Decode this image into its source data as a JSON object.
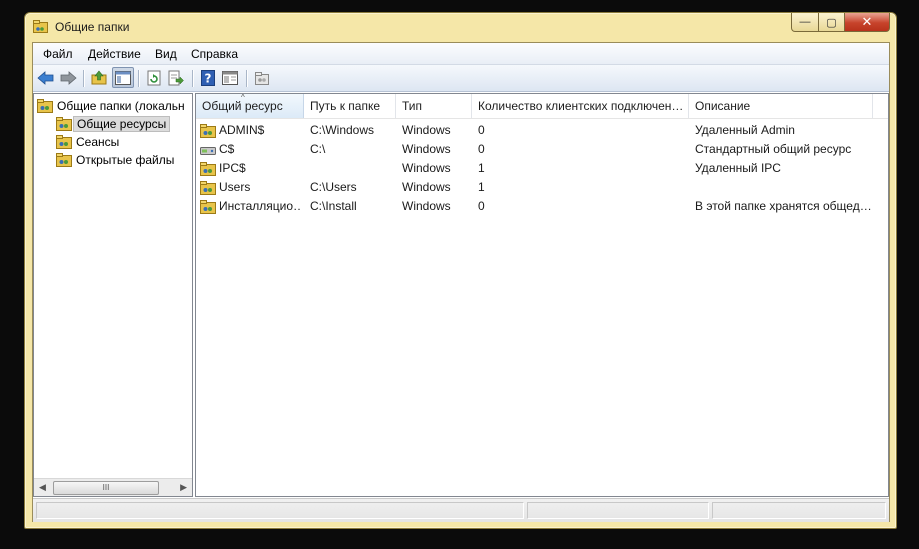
{
  "window": {
    "title": "Общие папки"
  },
  "caption": {
    "minimize": "—",
    "maximize": "▢",
    "close": "✕"
  },
  "menu": [
    {
      "label": "Файл"
    },
    {
      "label": "Действие"
    },
    {
      "label": "Вид"
    },
    {
      "label": "Справка"
    }
  ],
  "toolbar": {
    "buttons": [
      {
        "name": "back-arrow-icon"
      },
      {
        "name": "forward-arrow-icon"
      },
      {
        "name": "up-folder-icon"
      },
      {
        "name": "show-hide-tree-icon",
        "pressed": true
      },
      {
        "name": "refresh-icon"
      },
      {
        "name": "export-list-icon"
      },
      {
        "name": "help-icon"
      },
      {
        "name": "properties-icon"
      },
      {
        "name": "new-share-icon"
      }
    ]
  },
  "tree": {
    "root": "Общие папки (локальн",
    "items": [
      {
        "label": "Общие ресурсы",
        "selected": true
      },
      {
        "label": "Сеансы"
      },
      {
        "label": "Открытые файлы"
      }
    ],
    "scroll_grip": "III"
  },
  "list": {
    "columns": [
      {
        "label": "Общий ресурс",
        "sorted": true
      },
      {
        "label": "Путь к папке"
      },
      {
        "label": "Тип"
      },
      {
        "label": "Количество клиентских подключен…"
      },
      {
        "label": "Описание"
      }
    ],
    "rows": [
      {
        "icon": "shared-folder-icon",
        "name": "ADMIN$",
        "path": "C:\\Windows",
        "type": "Windows",
        "clients": "0",
        "description": "Удаленный Admin"
      },
      {
        "icon": "shared-drive-icon",
        "name": "C$",
        "path": "C:\\",
        "type": "Windows",
        "clients": "0",
        "description": "Стандартный общий ресурс"
      },
      {
        "icon": "shared-folder-icon",
        "name": "IPC$",
        "path": "",
        "type": "Windows",
        "clients": "1",
        "description": "Удаленный IPC"
      },
      {
        "icon": "shared-folder-icon",
        "name": "Users",
        "path": "C:\\Users",
        "type": "Windows",
        "clients": "1",
        "description": ""
      },
      {
        "icon": "shared-folder-icon",
        "name": "Инсталляцио…",
        "path": "C:\\Install",
        "type": "Windows",
        "clients": "0",
        "description": "В этой папке хранятся общед…"
      }
    ]
  },
  "colors": {
    "frame": "#f5e7a8",
    "folder": "#e8c44a",
    "sort_header": "#dceaf7"
  }
}
